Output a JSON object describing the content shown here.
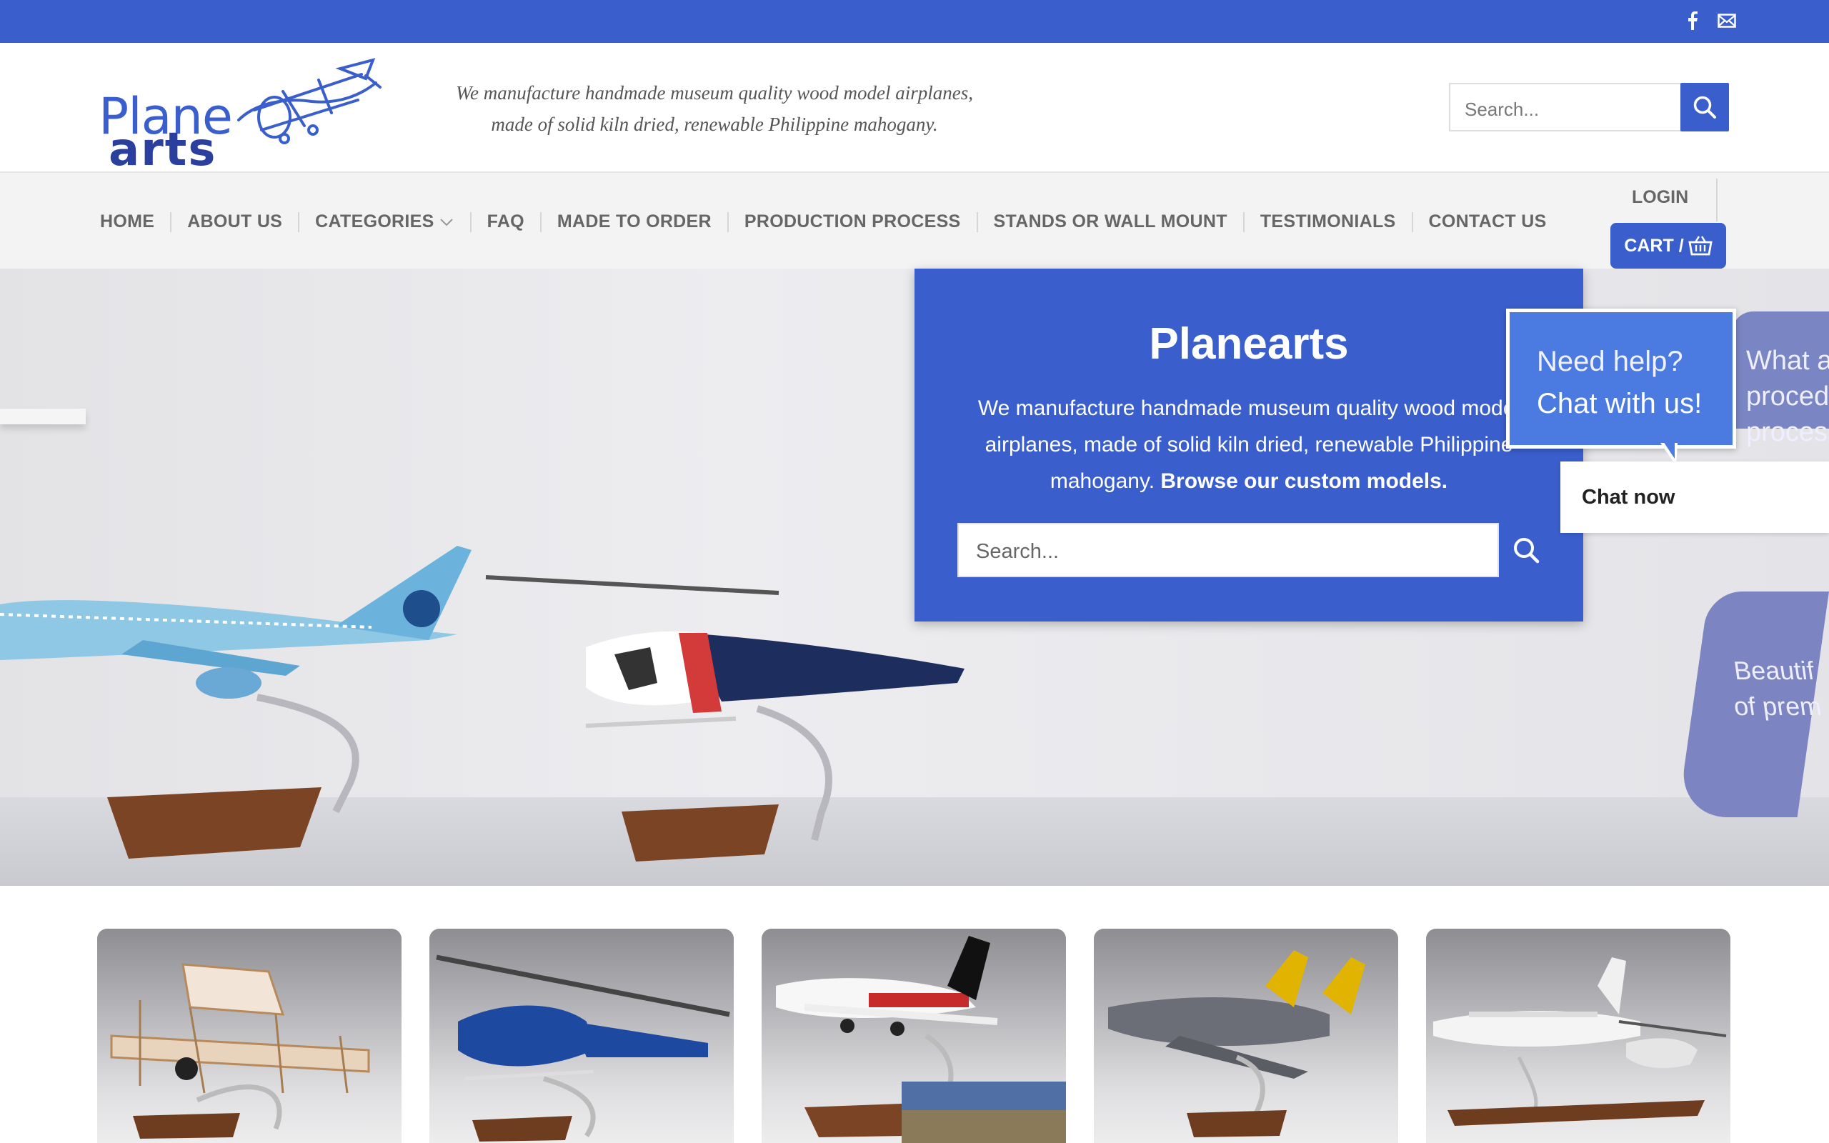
{
  "topbar": {
    "icons": [
      "facebook-icon",
      "envelope-icon"
    ]
  },
  "header": {
    "logo_top": "Plane",
    "logo_bottom": "arts",
    "tagline_line1": "We manufacture handmade museum quality wood model airplanes,",
    "tagline_line2": "made of solid kiln dried, renewable Philippine mahogany.",
    "search_placeholder": "Search..."
  },
  "nav": {
    "items": [
      {
        "label": "HOME"
      },
      {
        "label": "ABOUT US"
      },
      {
        "label": "CATEGORIES"
      },
      {
        "label": "FAQ"
      },
      {
        "label": "MADE TO ORDER"
      },
      {
        "label": "PRODUCTION PROCESS"
      },
      {
        "label": "STANDS OR WALL MOUNT"
      },
      {
        "label": "TESTIMONIALS"
      },
      {
        "label": "CONTACT US"
      }
    ],
    "login_label": "LOGIN",
    "cart_label": "CART /"
  },
  "hero": {
    "title": "Planearts",
    "text": "We manufacture handmade museum quality wood model airplanes, made of solid kiln dried, renewable Philippine mahogany.",
    "link_text": "Browse our custom models.",
    "search_placeholder": "Search..."
  },
  "chat": {
    "line1": "Need help?",
    "line2": "Chat with us!",
    "button": "Chat now"
  },
  "side_panels": {
    "panel1_lines": [
      "What a s",
      "procedur",
      "process v"
    ],
    "panel2_lines": [
      "Beautif",
      "of prem"
    ]
  },
  "colors": {
    "brand_blue": "#3a5fcd",
    "nav_bg": "#f3f3f3"
  }
}
